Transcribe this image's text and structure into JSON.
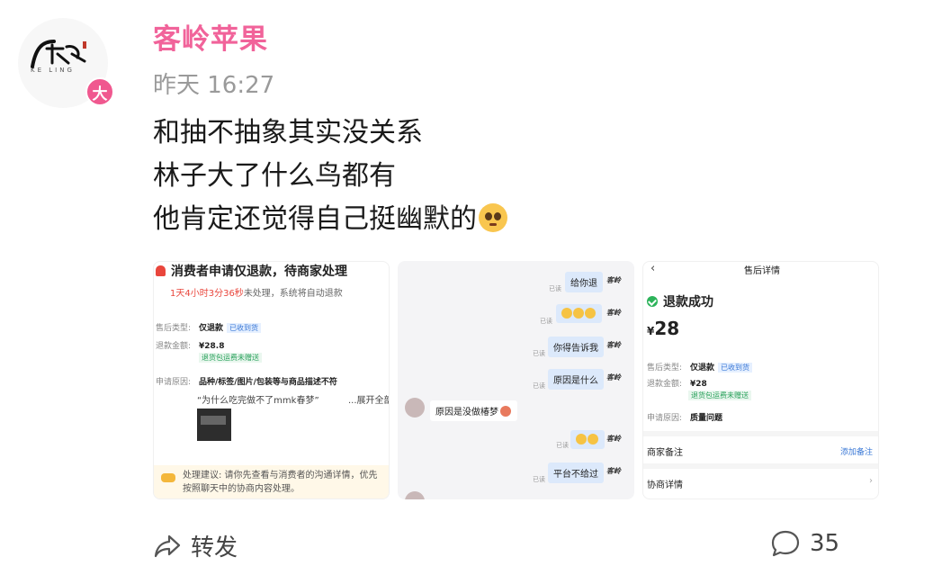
{
  "author": {
    "name": "客岭苹果",
    "avatar_logo_text": "客岭",
    "avatar_sub_text": "KE LING",
    "badge": "大"
  },
  "post": {
    "time": "昨天 16:27",
    "lines": [
      "和抽不抽象其实没关系",
      "林子大了什么鸟都有",
      "他肯定还觉得自己挺幽默的"
    ],
    "emoji": "pleading-face"
  },
  "image1": {
    "heading": "消费者申请仅退款，待商家处理",
    "timer_red": "1天4小时3分36秒",
    "timer_rest": "未处理，系统将自动退款",
    "type_label": "售后类型:",
    "type_value": "仅退款",
    "type_tag": "已收到货",
    "amount_label": "退款金额:",
    "amount_value": "¥28.8",
    "amount_tag": "退货包运费未赠送",
    "reason_label": "申请原因:",
    "reason_value": "品种/标签/图片/包装等与商品描述不符",
    "quote": "“为什么吃完做不了mmk春梦”",
    "expand": "...展开全部",
    "advice": "处理建议: 请你先查看与消费者的沟通详情，优先按照聊天中的协商内容处理。"
  },
  "image2": {
    "messages": [
      {
        "text": "给你退",
        "read": "已读"
      },
      {
        "text": "",
        "read": "已读"
      },
      {
        "text": "你得告诉我",
        "read": "已读"
      },
      {
        "text": "原因是什么",
        "read": "已读"
      },
      {
        "text": "",
        "read": "已读"
      },
      {
        "text": "平台不给过",
        "read": "已读"
      }
    ],
    "customer_message": "原因是没做椿梦",
    "logo": "客岭"
  },
  "image3": {
    "title": "售后详情",
    "status": "退款成功",
    "currency": "¥",
    "amount": "28",
    "type_label": "售后类型:",
    "type_value": "仅退款",
    "type_tag": "已收到货",
    "amount_label": "退款金额:",
    "amount_value": "¥28",
    "amount_tag": "退货包运费未赠送",
    "reason_label": "申请原因:",
    "reason_value": "质量问题",
    "merchant_note": "商家备注",
    "add_note": "添加备注",
    "negotiation": "协商详情"
  },
  "footer": {
    "share_label": "转发",
    "comment_count": "35"
  },
  "colors": {
    "username": "#f1639a",
    "badge": "#f0588f",
    "timestamp": "#9a9a9a"
  }
}
